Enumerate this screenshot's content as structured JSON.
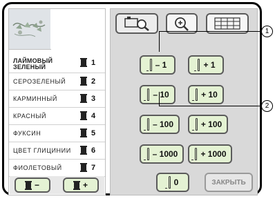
{
  "threads": [
    {
      "name": "ЛАЙМОВЫЙ ЗЕЛЕНЫЙ",
      "num": "1"
    },
    {
      "name": "СЕРОЗЕЛЕНЫЙ",
      "num": "2"
    },
    {
      "name": "КАРМИННЫЙ",
      "num": "3"
    },
    {
      "name": "КРАСНЫЙ",
      "num": "4"
    },
    {
      "name": "ФУКСИН",
      "num": "5"
    },
    {
      "name": "ЦВЕТ ГЛИЦИНИИ",
      "num": "6"
    },
    {
      "name": "ФИОЛЕТОВЫЙ",
      "num": "7"
    }
  ],
  "left_buttons": {
    "minus": "−",
    "plus": "+"
  },
  "step_buttons": {
    "m1": "– 1",
    "p1": "+ 1",
    "m10": "– 10",
    "p10": "+ 10",
    "m100": "– 100",
    "p100": "+ 100",
    "m1000": "– 1000",
    "p1000": "+ 1000",
    "zero": "0"
  },
  "close_button": "ЗАКРЫТЬ",
  "callouts": {
    "one": "1",
    "two": "2"
  },
  "icons": {
    "toolbar": [
      "stitch-magnify-icon",
      "zoom-icon",
      "grid-icon"
    ],
    "preview": "embroidery-pattern-preview"
  },
  "colors": {
    "button_green": "#e4f2d3",
    "panel_gray": "#d9d9d9",
    "border": "#5b5b5b"
  }
}
